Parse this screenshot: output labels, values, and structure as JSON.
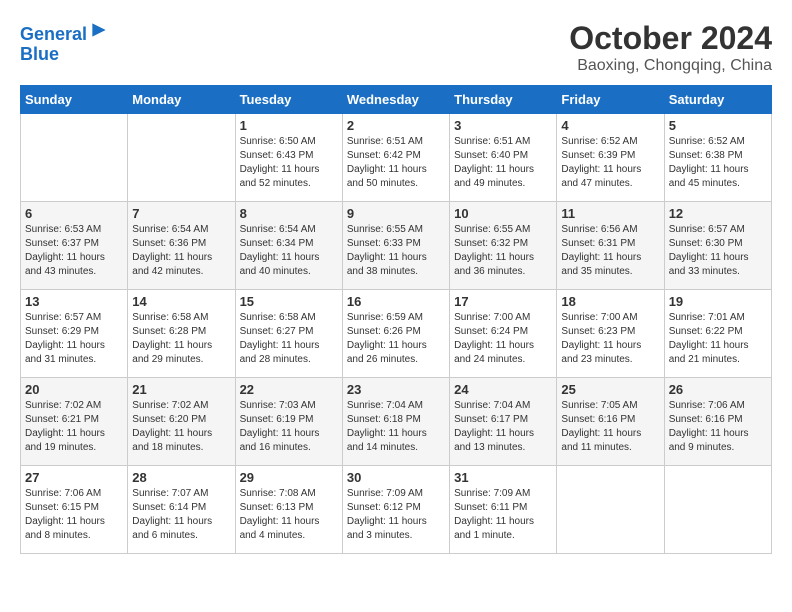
{
  "header": {
    "logo_line1": "General",
    "logo_line2": "Blue",
    "month": "October 2024",
    "location": "Baoxing, Chongqing, China"
  },
  "weekdays": [
    "Sunday",
    "Monday",
    "Tuesday",
    "Wednesday",
    "Thursday",
    "Friday",
    "Saturday"
  ],
  "weeks": [
    [
      {
        "day": "",
        "detail": ""
      },
      {
        "day": "",
        "detail": ""
      },
      {
        "day": "1",
        "detail": "Sunrise: 6:50 AM\nSunset: 6:43 PM\nDaylight: 11 hours and 52 minutes."
      },
      {
        "day": "2",
        "detail": "Sunrise: 6:51 AM\nSunset: 6:42 PM\nDaylight: 11 hours and 50 minutes."
      },
      {
        "day": "3",
        "detail": "Sunrise: 6:51 AM\nSunset: 6:40 PM\nDaylight: 11 hours and 49 minutes."
      },
      {
        "day": "4",
        "detail": "Sunrise: 6:52 AM\nSunset: 6:39 PM\nDaylight: 11 hours and 47 minutes."
      },
      {
        "day": "5",
        "detail": "Sunrise: 6:52 AM\nSunset: 6:38 PM\nDaylight: 11 hours and 45 minutes."
      }
    ],
    [
      {
        "day": "6",
        "detail": "Sunrise: 6:53 AM\nSunset: 6:37 PM\nDaylight: 11 hours and 43 minutes."
      },
      {
        "day": "7",
        "detail": "Sunrise: 6:54 AM\nSunset: 6:36 PM\nDaylight: 11 hours and 42 minutes."
      },
      {
        "day": "8",
        "detail": "Sunrise: 6:54 AM\nSunset: 6:34 PM\nDaylight: 11 hours and 40 minutes."
      },
      {
        "day": "9",
        "detail": "Sunrise: 6:55 AM\nSunset: 6:33 PM\nDaylight: 11 hours and 38 minutes."
      },
      {
        "day": "10",
        "detail": "Sunrise: 6:55 AM\nSunset: 6:32 PM\nDaylight: 11 hours and 36 minutes."
      },
      {
        "day": "11",
        "detail": "Sunrise: 6:56 AM\nSunset: 6:31 PM\nDaylight: 11 hours and 35 minutes."
      },
      {
        "day": "12",
        "detail": "Sunrise: 6:57 AM\nSunset: 6:30 PM\nDaylight: 11 hours and 33 minutes."
      }
    ],
    [
      {
        "day": "13",
        "detail": "Sunrise: 6:57 AM\nSunset: 6:29 PM\nDaylight: 11 hours and 31 minutes."
      },
      {
        "day": "14",
        "detail": "Sunrise: 6:58 AM\nSunset: 6:28 PM\nDaylight: 11 hours and 29 minutes."
      },
      {
        "day": "15",
        "detail": "Sunrise: 6:58 AM\nSunset: 6:27 PM\nDaylight: 11 hours and 28 minutes."
      },
      {
        "day": "16",
        "detail": "Sunrise: 6:59 AM\nSunset: 6:26 PM\nDaylight: 11 hours and 26 minutes."
      },
      {
        "day": "17",
        "detail": "Sunrise: 7:00 AM\nSunset: 6:24 PM\nDaylight: 11 hours and 24 minutes."
      },
      {
        "day": "18",
        "detail": "Sunrise: 7:00 AM\nSunset: 6:23 PM\nDaylight: 11 hours and 23 minutes."
      },
      {
        "day": "19",
        "detail": "Sunrise: 7:01 AM\nSunset: 6:22 PM\nDaylight: 11 hours and 21 minutes."
      }
    ],
    [
      {
        "day": "20",
        "detail": "Sunrise: 7:02 AM\nSunset: 6:21 PM\nDaylight: 11 hours and 19 minutes."
      },
      {
        "day": "21",
        "detail": "Sunrise: 7:02 AM\nSunset: 6:20 PM\nDaylight: 11 hours and 18 minutes."
      },
      {
        "day": "22",
        "detail": "Sunrise: 7:03 AM\nSunset: 6:19 PM\nDaylight: 11 hours and 16 minutes."
      },
      {
        "day": "23",
        "detail": "Sunrise: 7:04 AM\nSunset: 6:18 PM\nDaylight: 11 hours and 14 minutes."
      },
      {
        "day": "24",
        "detail": "Sunrise: 7:04 AM\nSunset: 6:17 PM\nDaylight: 11 hours and 13 minutes."
      },
      {
        "day": "25",
        "detail": "Sunrise: 7:05 AM\nSunset: 6:16 PM\nDaylight: 11 hours and 11 minutes."
      },
      {
        "day": "26",
        "detail": "Sunrise: 7:06 AM\nSunset: 6:16 PM\nDaylight: 11 hours and 9 minutes."
      }
    ],
    [
      {
        "day": "27",
        "detail": "Sunrise: 7:06 AM\nSunset: 6:15 PM\nDaylight: 11 hours and 8 minutes."
      },
      {
        "day": "28",
        "detail": "Sunrise: 7:07 AM\nSunset: 6:14 PM\nDaylight: 11 hours and 6 minutes."
      },
      {
        "day": "29",
        "detail": "Sunrise: 7:08 AM\nSunset: 6:13 PM\nDaylight: 11 hours and 4 minutes."
      },
      {
        "day": "30",
        "detail": "Sunrise: 7:09 AM\nSunset: 6:12 PM\nDaylight: 11 hours and 3 minutes."
      },
      {
        "day": "31",
        "detail": "Sunrise: 7:09 AM\nSunset: 6:11 PM\nDaylight: 11 hours and 1 minute."
      },
      {
        "day": "",
        "detail": ""
      },
      {
        "day": "",
        "detail": ""
      }
    ]
  ]
}
